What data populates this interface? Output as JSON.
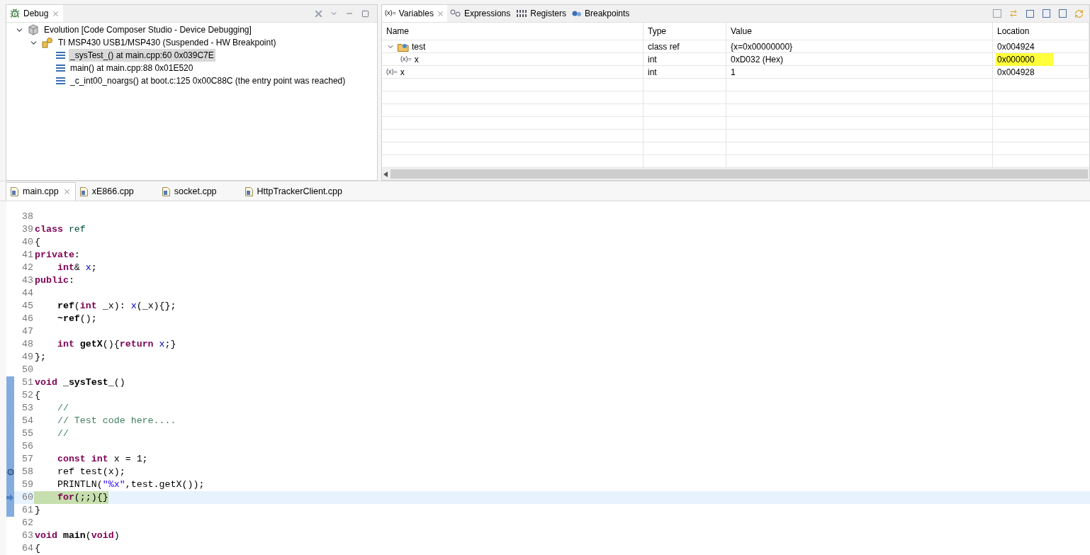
{
  "debug_view": {
    "tab": {
      "label": "Debug",
      "selected": true
    },
    "tree": [
      {
        "label": "Evolution [Code Composer Studio - Device Debugging]",
        "kind": "launch",
        "expanded": true,
        "children": [
          {
            "label": "TI MSP430 USB1/MSP430 (Suspended - HW Breakpoint)",
            "kind": "target",
            "expanded": true,
            "children": [
              {
                "label": "_sysTest_() at main.cpp:60 0x039C7E",
                "kind": "frame",
                "selected": true
              },
              {
                "label": "main() at main.cpp:88 0x01E520",
                "kind": "frame",
                "selected": false
              },
              {
                "label": "_c_int00_noargs() at boot.c:125 0x00C88C  (the entry point was reached)",
                "kind": "frame",
                "selected": false
              }
            ]
          }
        ]
      }
    ]
  },
  "variables_view": {
    "tabs": [
      {
        "label": "Variables",
        "icon_text": "(x)=",
        "selected": true
      },
      {
        "label": "Expressions",
        "selected": false
      },
      {
        "label": "Registers",
        "selected": false
      },
      {
        "label": "Breakpoints",
        "selected": false
      }
    ],
    "columns": [
      "Name",
      "Type",
      "Value",
      "Location"
    ],
    "rows": [
      {
        "name": "test",
        "type": "class ref",
        "value": "{x=0x00000000}",
        "location": "0x004924",
        "kind": "object",
        "expanded": true,
        "highlighted": false,
        "children": [
          {
            "name": "x",
            "icon_text": "(x)=",
            "type": "int",
            "value": "0xD032 (Hex)",
            "location": "0x000000",
            "kind": "var",
            "highlighted": true
          }
        ]
      },
      {
        "name": "x",
        "icon_text": "(x)=",
        "type": "int",
        "value": "1",
        "location": "0x004928",
        "kind": "var",
        "highlighted": false
      }
    ]
  },
  "editor": {
    "tabs": [
      {
        "label": "main.cpp",
        "selected": true
      },
      {
        "label": "xE866.cpp",
        "selected": false
      },
      {
        "label": "socket.cpp",
        "selected": false
      },
      {
        "label": "HttpTrackerClient.cpp",
        "selected": false
      }
    ],
    "lines": [
      {
        "number": "38"
      },
      {
        "number": "39",
        "tokens": [
          {
            "kind": "kw",
            "text": "class"
          },
          {
            "kind": "cls",
            "text": " ref"
          }
        ]
      },
      {
        "number": "40",
        "tokens": [
          {
            "kind": "plain",
            "text": "{"
          }
        ]
      },
      {
        "number": "41",
        "tokens": [
          {
            "kind": "kw",
            "text": "private"
          },
          {
            "kind": "plain",
            "text": ":"
          }
        ]
      },
      {
        "number": "42",
        "tokens": [
          {
            "kind": "kw",
            "text": "    int"
          },
          {
            "kind": "plain",
            "text": "& "
          },
          {
            "kind": "field",
            "text": "x"
          },
          {
            "kind": "plain",
            "text": ";"
          }
        ]
      },
      {
        "number": "43",
        "tokens": [
          {
            "kind": "kw",
            "text": "public"
          },
          {
            "kind": "plain",
            "text": ":"
          }
        ]
      },
      {
        "number": "44"
      },
      {
        "number": "45",
        "tokens": [
          {
            "kind": "bold",
            "text": "    ref"
          },
          {
            "kind": "plain",
            "text": "("
          },
          {
            "kind": "kw",
            "text": "int"
          },
          {
            "kind": "plain",
            "text": " _x): "
          },
          {
            "kind": "field",
            "text": "x"
          },
          {
            "kind": "plain",
            "text": "(_x){};"
          }
        ]
      },
      {
        "number": "46",
        "tokens": [
          {
            "kind": "bold",
            "text": "    ~ref"
          },
          {
            "kind": "plain",
            "text": "();"
          }
        ]
      },
      {
        "number": "47"
      },
      {
        "number": "48",
        "tokens": [
          {
            "kind": "kw",
            "text": "    int"
          },
          {
            "kind": "bold",
            "text": " getX"
          },
          {
            "kind": "plain",
            "text": "(){"
          },
          {
            "kind": "kw",
            "text": "return"
          },
          {
            "kind": "field",
            "text": " x"
          },
          {
            "kind": "plain",
            "text": ";}"
          }
        ]
      },
      {
        "number": "49",
        "tokens": [
          {
            "kind": "plain",
            "text": "};"
          }
        ]
      },
      {
        "number": "50"
      },
      {
        "number": "51",
        "range": true,
        "tokens": [
          {
            "kind": "kw",
            "text": "void"
          },
          {
            "kind": "bold",
            "text": " _sysTest_"
          },
          {
            "kind": "plain",
            "text": "()"
          }
        ]
      },
      {
        "number": "52",
        "range": true,
        "tokens": [
          {
            "kind": "plain",
            "text": "{"
          }
        ]
      },
      {
        "number": "53",
        "range": true,
        "tokens": [
          {
            "kind": "comment",
            "text": "    //"
          }
        ]
      },
      {
        "number": "54",
        "range": true,
        "tokens": [
          {
            "kind": "comment",
            "text": "    // Test code here...."
          }
        ]
      },
      {
        "number": "55",
        "range": true,
        "tokens": [
          {
            "kind": "comment",
            "text": "    //"
          }
        ]
      },
      {
        "number": "56",
        "range": true
      },
      {
        "number": "57",
        "range": true,
        "tokens": [
          {
            "kind": "kw",
            "text": "    const int"
          },
          {
            "kind": "plain",
            "text": " x = 1;"
          }
        ]
      },
      {
        "number": "58",
        "range": true,
        "breakpoint": true,
        "tokens": [
          {
            "kind": "plain",
            "text": "    ref test(x);"
          }
        ]
      },
      {
        "number": "59",
        "range": true,
        "tokens": [
          {
            "kind": "plain",
            "text": "    PRINTLN("
          },
          {
            "kind": "string",
            "text": "\"%x\""
          },
          {
            "kind": "plain",
            "text": ",test.getX());"
          }
        ]
      },
      {
        "number": "60",
        "range": true,
        "current": true,
        "tokens": [
          {
            "kind": "kw",
            "text": "    for"
          },
          {
            "kind": "plain",
            "text": "(;;){}"
          }
        ]
      },
      {
        "number": "61",
        "range": true,
        "tokens": [
          {
            "kind": "plain",
            "text": "}"
          }
        ]
      },
      {
        "number": "62"
      },
      {
        "number": "63",
        "tokens": [
          {
            "kind": "kw",
            "text": "void"
          },
          {
            "kind": "bold",
            "text": " main"
          },
          {
            "kind": "plain",
            "text": "("
          },
          {
            "kind": "kw",
            "text": "void"
          },
          {
            "kind": "plain",
            "text": ")"
          }
        ]
      },
      {
        "number": "64",
        "tokens": [
          {
            "kind": "plain",
            "text": "{"
          }
        ]
      }
    ]
  }
}
